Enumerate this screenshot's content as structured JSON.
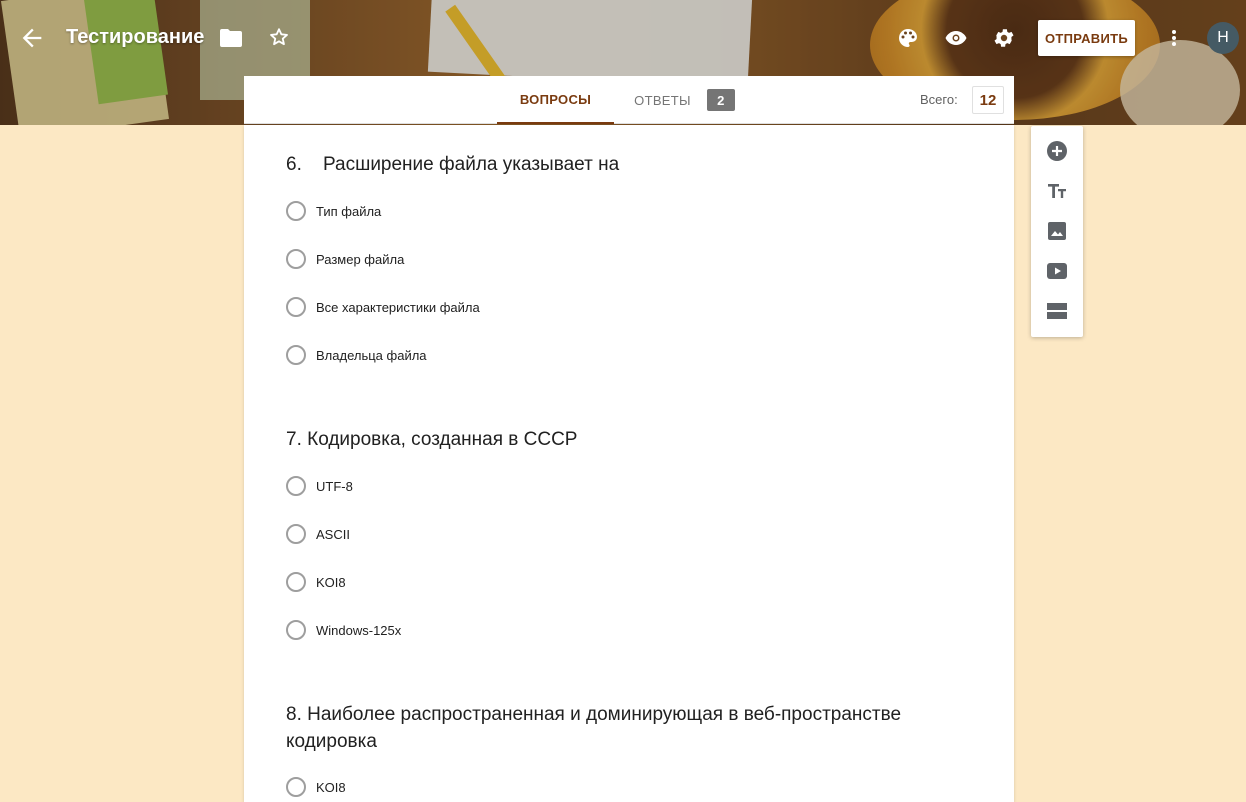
{
  "header": {
    "title": "Тестирование",
    "send_label": "ОТПРАВИТЬ",
    "avatar_letter": "Н",
    "icons": [
      "back-arrow-icon",
      "folder-icon",
      "star-icon",
      "palette-icon",
      "eye-icon",
      "gear-icon",
      "more-vert-icon"
    ]
  },
  "tabs": {
    "questions_label": "ВОПРОСЫ",
    "answers_label": "ОТВЕТЫ",
    "answers_count": "2",
    "total_label": "Всего:",
    "total_value": "12"
  },
  "questions": [
    {
      "title": "6.    Расширение файла указывает на",
      "options": [
        "Тип файла",
        "Размер файла",
        "Все характеристики файла",
        "Владельца файла"
      ]
    },
    {
      "title": "7. Кодировка, созданная в СССР",
      "options": [
        "UTF-8",
        "ASCII",
        "KOI8",
        "Windows-125x"
      ]
    },
    {
      "title": "8. Наиболее распространенная и доминирующая в веб-пространстве кодировка",
      "options": [
        "KOI8"
      ]
    }
  ],
  "toolbar": {
    "icons": [
      "add-question-icon",
      "title-text-icon",
      "image-icon",
      "video-icon",
      "section-icon"
    ]
  },
  "colors": {
    "accent": "#7a3b10",
    "page_background": "#fce8c4"
  }
}
